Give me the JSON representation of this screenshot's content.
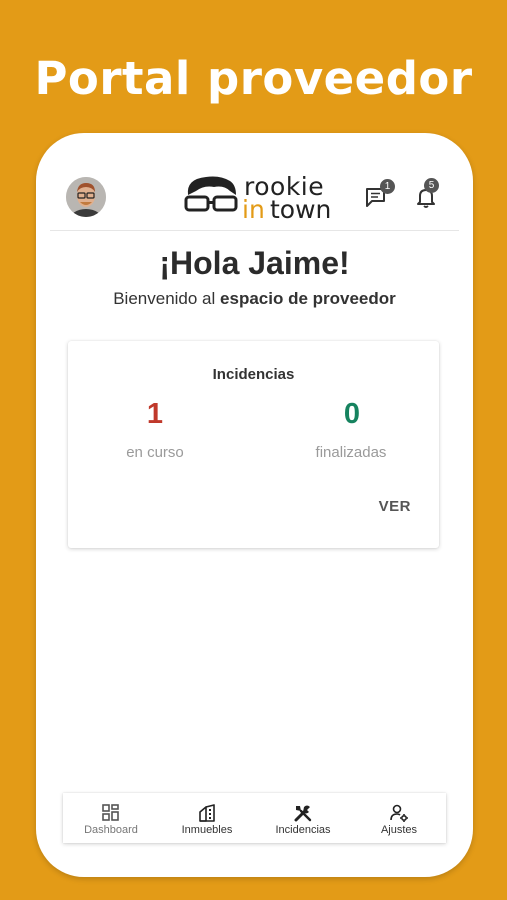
{
  "headline": "Portal proveedor",
  "header": {
    "logo_top": "rookie",
    "logo_in": "in",
    "logo_town": "town",
    "messages_badge": "1",
    "notifications_badge": "5"
  },
  "greeting": {
    "title": "¡Hola Jaime!",
    "welcome_prefix": "Bienvenido al ",
    "welcome_bold": "espacio de proveedor"
  },
  "incidents_card": {
    "title": "Incidencias",
    "in_progress_count": "1",
    "in_progress_label": "en curso",
    "finished_count": "0",
    "finished_label": "finalizadas",
    "view_button": "VER"
  },
  "bottom_nav": {
    "items": [
      {
        "label": "Dashboard",
        "icon": "dashboard-grid-icon"
      },
      {
        "label": "Inmuebles",
        "icon": "building-icon"
      },
      {
        "label": "Incidencias",
        "icon": "tools-icon"
      },
      {
        "label": "Ajustes",
        "icon": "user-settings-icon"
      }
    ]
  },
  "colors": {
    "background": "#E39B17",
    "in_progress": "#C0392B",
    "finished": "#16835F",
    "logo_accent": "#E39B17"
  }
}
